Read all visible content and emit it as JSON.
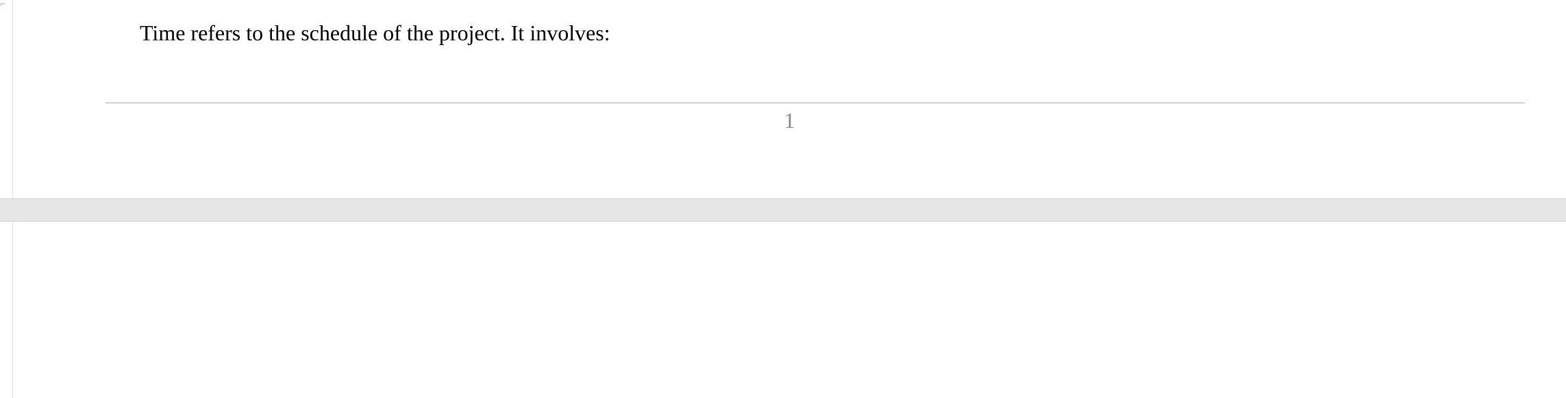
{
  "document": {
    "body_text": "Time refers to the schedule of the project. It involves:",
    "page_number": "1"
  }
}
